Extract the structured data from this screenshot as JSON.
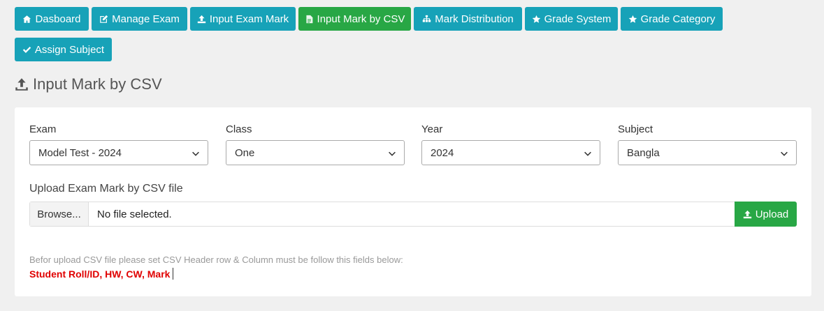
{
  "nav": {
    "items": [
      {
        "label": "Dasboard",
        "icon": "home-icon"
      },
      {
        "label": "Manage Exam",
        "icon": "edit-icon"
      },
      {
        "label": "Input Exam Mark",
        "icon": "upload-icon"
      },
      {
        "label": "Input Mark by CSV",
        "icon": "csv-file-icon",
        "active": true
      },
      {
        "label": "Mark Distribution",
        "icon": "sitemap-icon"
      },
      {
        "label": "Grade System",
        "icon": "star-icon"
      },
      {
        "label": "Grade Category",
        "icon": "star-icon"
      },
      {
        "label": "Assign Subject",
        "icon": "check-icon"
      }
    ]
  },
  "page": {
    "title": "Input Mark by CSV",
    "icon": "upload-icon"
  },
  "form": {
    "exam": {
      "label": "Exam",
      "value": "Model Test - 2024"
    },
    "class": {
      "label": "Class",
      "value": "One"
    },
    "year": {
      "label": "Year",
      "value": "2024"
    },
    "subject": {
      "label": "Subject",
      "value": "Bangla"
    },
    "upload_label": "Upload Exam Mark by CSV file",
    "browse_label": "Browse...",
    "file_status": "No file selected.",
    "upload_button": "Upload",
    "note": "Befor upload CSV file please set CSV Header row & Column must be follow this fields below:",
    "required_fields": "Student Roll/ID, HW, CW, Mark"
  },
  "colors": {
    "nav_button": "#17a2b8",
    "active_button": "#28a745",
    "upload_button": "#28a745",
    "required_fields": "#e00000",
    "background": "#f0f0f0"
  }
}
